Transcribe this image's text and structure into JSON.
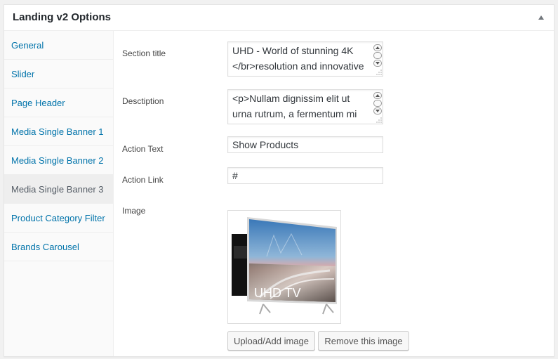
{
  "postbox": {
    "title": "Landing v2 Options"
  },
  "tabs": [
    {
      "label": "General"
    },
    {
      "label": "Slider"
    },
    {
      "label": "Page Header"
    },
    {
      "label": "Media Single Banner 1"
    },
    {
      "label": "Media Single Banner 2"
    },
    {
      "label": "Media Single Banner 3"
    },
    {
      "label": "Product Category Filter"
    },
    {
      "label": "Brands Carousel"
    }
  ],
  "active_tab": "Media Single Banner 3",
  "fields": {
    "section_title": {
      "label": "Section title",
      "value": "UHD - World of stunning 4K </br>resolution and innovative"
    },
    "description": {
      "label": "Desctiption",
      "value": "<p>Nullam dignissim elit ut urna rutrum, a fermentum mi"
    },
    "action_text": {
      "label": "Action Text",
      "value": "Show Products"
    },
    "action_link": {
      "label": "Action Link",
      "value": "#"
    },
    "image": {
      "label": "Image",
      "image_text": "UHD TV"
    }
  },
  "buttons": {
    "upload": "Upload/Add image",
    "remove": "Remove this image"
  },
  "icons": {
    "collapse": "triangle-up-icon",
    "scroll_up": "scroll-up-arrow-icon",
    "scroll_down": "scroll-down-arrow-icon"
  },
  "colors": {
    "link": "#0073aa",
    "active_tab_bg": "#eeeeee"
  }
}
